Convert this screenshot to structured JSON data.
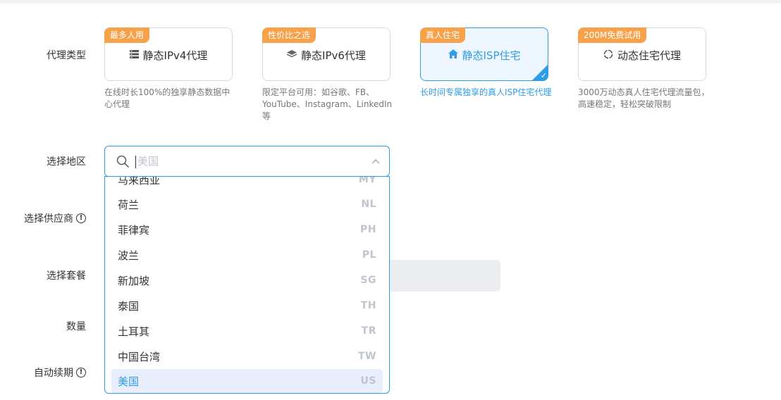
{
  "labels": {
    "proxy_type": "代理类型",
    "region": "选择地区",
    "provider": "选择供应商",
    "plan": "选择套餐",
    "quantity": "数量",
    "auto_renew": "自动续期"
  },
  "info_icon_glyph": "!",
  "cards": [
    {
      "badge": "最多人用",
      "icon": "server-icon",
      "title": "静态IPv4代理",
      "desc": "在线时长100%的独享静态数据中心代理",
      "active": false
    },
    {
      "badge": "性价比之选",
      "icon": "layers-icon",
      "title": "静态IPv6代理",
      "desc": "限定平台可用：如谷歌、FB、YouTube、Instagram、LinkedIn等",
      "active": false
    },
    {
      "badge": "真人住宅",
      "icon": "home-icon",
      "title": "静态ISP住宅",
      "desc": "长时间专属独享的真人ISP住宅代理",
      "active": true
    },
    {
      "badge": "200M免费试用",
      "icon": "refresh-icon",
      "title": "动态住宅代理",
      "desc": "3000万动态真人住宅代理流量包，高速稳定，轻松突破限制",
      "active": false
    }
  ],
  "region_select": {
    "placeholder": "美国"
  },
  "region_options": [
    {
      "name": "马来西亚",
      "code": "MY"
    },
    {
      "name": "荷兰",
      "code": "NL"
    },
    {
      "name": "菲律宾",
      "code": "PH"
    },
    {
      "name": "波兰",
      "code": "PL"
    },
    {
      "name": "新加坡",
      "code": "SG"
    },
    {
      "name": "泰国",
      "code": "TH"
    },
    {
      "name": "土耳其",
      "code": "TR"
    },
    {
      "name": "中国台湾",
      "code": "TW"
    },
    {
      "name": "美国",
      "code": "US",
      "selected": true
    }
  ],
  "colors": {
    "accent": "#2f9ce8",
    "badge": "#f7a24a",
    "selected_bg": "#e8eefc"
  }
}
